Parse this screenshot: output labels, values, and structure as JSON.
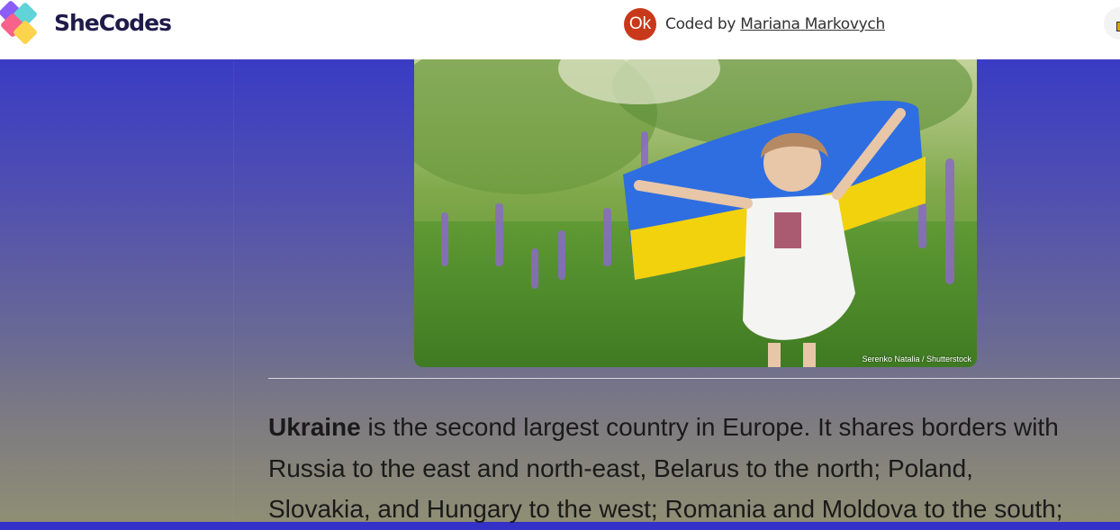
{
  "header": {
    "brand": "SheCodes",
    "avatar_initials": "Ok",
    "coded_by_prefix": "Coded by",
    "author_name": "Mariana Markovych"
  },
  "hero_image": {
    "credit": "Serenko Natalia / Shutterstock"
  },
  "article": {
    "lead": "Ukraine",
    "line1": " is the second largest country in Europe. It shares borders with",
    "line2": "Russia to the east and north-east, Belarus to the north; Poland,",
    "line3": "Slovakia, and Hungary to the west; Romania and Moldova to the south;"
  },
  "colors": {
    "brand_text": "#1e1b4a",
    "avatar_bg": "#c9381a",
    "flag_blue": "#2f6ee0",
    "flag_yellow": "#f2d20c"
  }
}
